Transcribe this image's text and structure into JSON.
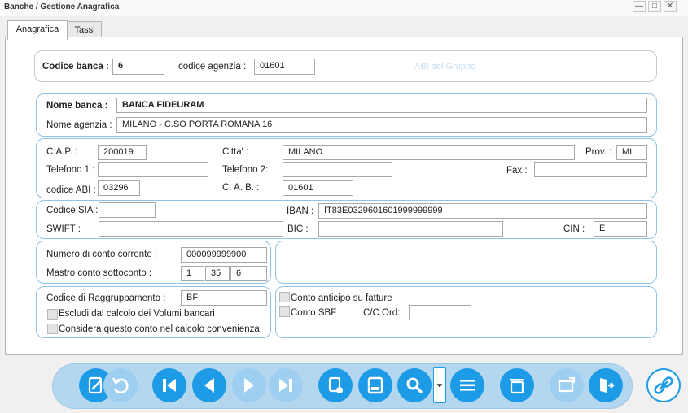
{
  "window": {
    "title": "Banche / Gestione Anagrafica",
    "minimize": "—",
    "maximize": "□",
    "close": "✕"
  },
  "tabs": [
    {
      "label": "Anagrafica",
      "active": true
    },
    {
      "label": "Tassi",
      "active": false
    }
  ],
  "codice": {
    "codice_banca_label": "Codice banca :",
    "codice_banca_value": "6",
    "codice_agenzia_label": "codice agenzia :",
    "codice_agenzia_value": "01601",
    "abi_gruppo": "ABI del Gruppo"
  },
  "nome": {
    "nome_banca_label": "Nome banca :",
    "nome_banca_value": "BANCA FIDEURAM",
    "nome_agenzia_label": "Nome agenzia :",
    "nome_agenzia_value": "MILANO - C.SO PORTA ROMANA 16"
  },
  "indirizzo": {
    "cap_label": "C.A.P. :",
    "cap_value": "200019",
    "citta_label": "Citta' :",
    "citta_value": "MILANO",
    "prov_label": "Prov. :",
    "prov_value": "MI",
    "telefono1_label": "Telefono 1 :",
    "telefono1_value": "",
    "telefono2_label": "Telefono 2:",
    "telefono2_value": "",
    "fax_label": "Fax :",
    "fax_value": "",
    "abi_label": "codice ABI :",
    "abi_value": "03296",
    "cab_label": "C. A. B. :",
    "cab_value": "01601"
  },
  "sia": {
    "sia_label": "Codice SIA :",
    "sia_value": "",
    "iban_label": "IBAN :",
    "iban_value": "IT83E0329601601999999999",
    "swift_label": "SWIFT :",
    "swift_value": "",
    "bic_label": "BIC :",
    "bic_value": "",
    "cin_label": "CIN :",
    "cin_value": "E"
  },
  "conto": {
    "numero_label": "Numero di conto corrente :",
    "numero_value": "000099999900",
    "mastro_label": "Mastro conto sottoconto  :",
    "mastro_1": "1",
    "mastro_2": "35",
    "mastro_3": "6"
  },
  "raggruppamento": {
    "codice_label": "Codice di Raggruppamento :",
    "codice_value": "BFI",
    "escludi_label": "Escludi dal calcolo dei Volumi bancari",
    "considera_label": "Considera questo conto nel calcolo convenienza"
  },
  "anticipi": {
    "conto_anticipo_label": "Conto anticipo su fatture",
    "conto_sbf_label": "Conto SBF",
    "cc_ord_label": "C/C Ord:",
    "cc_ord_value": ""
  },
  "toolbar_icons": [
    "edit-note-icon",
    "undo-icon",
    "first-record-icon",
    "previous-record-icon",
    "next-record-icon",
    "last-record-icon",
    "new-record-icon",
    "save-icon",
    "search-icon",
    "dropdown-arrow-icon",
    "list-icon",
    "delete-icon",
    "export-icon",
    "exit-icon",
    "link-icon"
  ]
}
